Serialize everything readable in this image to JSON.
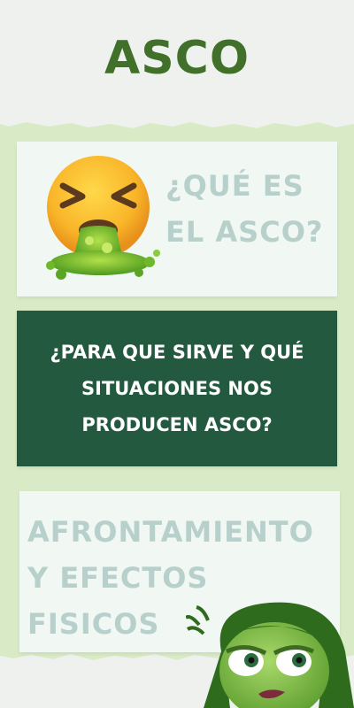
{
  "page": {
    "title": "ASCO",
    "colors": {
      "title": "#40702a",
      "band": "#d9ebc6",
      "background": "#eff1ef",
      "card_light": "#f1f7f2",
      "card_dark": "#235a3f",
      "light_text": "#b7d0cb"
    }
  },
  "cards": [
    {
      "text": "¿QUÉ ES EL ASCO?",
      "icon": "nauseated-vomit-emoji"
    },
    {
      "text": "¿PARA QUE SIRVE Y QUÉ SITUACIONES NOS PRODUCEN ASCO?"
    },
    {
      "text": "AFRONTAMIENTO Y EFECTOS FISICOS",
      "icon": "disgust-character"
    }
  ]
}
